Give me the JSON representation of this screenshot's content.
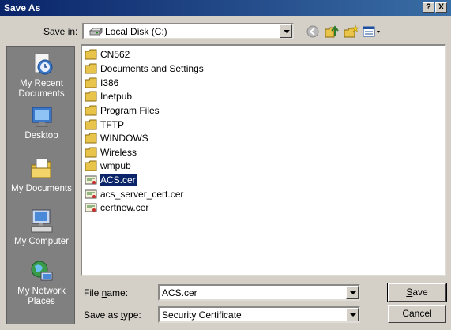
{
  "window": {
    "title": "Save As",
    "help_label": "?",
    "close_label": "X"
  },
  "save_in": {
    "label": "Save in:",
    "value": "Local Disk (C:)"
  },
  "toolbar": {
    "icons": [
      "back-icon",
      "up-folder-icon",
      "new-folder-icon",
      "views-menu-icon"
    ]
  },
  "places": [
    {
      "label": "My Recent Documents",
      "icon": "recent-documents-icon"
    },
    {
      "label": "Desktop",
      "icon": "desktop-icon"
    },
    {
      "label": "My Documents",
      "icon": "my-documents-icon"
    },
    {
      "label": "My Computer",
      "icon": "my-computer-icon"
    },
    {
      "label": "My Network Places",
      "icon": "network-places-icon"
    }
  ],
  "files": [
    {
      "name": "CN562",
      "type": "folder"
    },
    {
      "name": "Documents and Settings",
      "type": "folder"
    },
    {
      "name": "I386",
      "type": "folder"
    },
    {
      "name": "Inetpub",
      "type": "folder"
    },
    {
      "name": "Program Files",
      "type": "folder"
    },
    {
      "name": "TFTP",
      "type": "folder"
    },
    {
      "name": "WINDOWS",
      "type": "folder"
    },
    {
      "name": "Wireless",
      "type": "folder"
    },
    {
      "name": "wmpub",
      "type": "folder"
    },
    {
      "name": "ACS.cer",
      "type": "certificate",
      "selected": true
    },
    {
      "name": "acs_server_cert.cer",
      "type": "certificate"
    },
    {
      "name": "certnew.cer",
      "type": "certificate"
    }
  ],
  "file_name": {
    "label": "File name:",
    "value": "ACS.cer"
  },
  "save_as_type": {
    "label": "Save as type:",
    "value": "Security Certificate"
  },
  "buttons": {
    "save": "Save",
    "cancel": "Cancel"
  },
  "colors": {
    "title_bar": "#0a246a",
    "face": "#d4d0c8",
    "places_bar": "#808080",
    "selection": "#0a246a",
    "folder": "#e8c44a"
  }
}
